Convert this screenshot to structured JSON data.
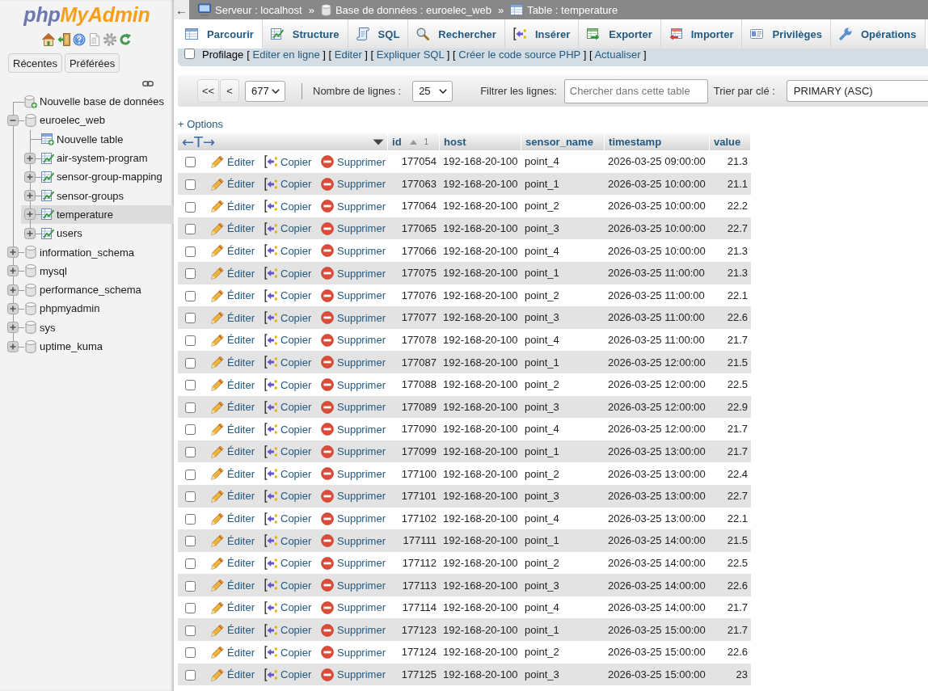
{
  "sidebar": {
    "logo": {
      "prefix": "php",
      "name": "MyAdmin"
    },
    "buttons": [
      "Récentes",
      "Préférées"
    ],
    "tree": [
      {
        "label": "Nouvelle base de données",
        "kind": "new_database",
        "selected": false
      },
      {
        "label": "euroelec_web",
        "kind": "database",
        "expanded": true,
        "selected": false,
        "children": [
          {
            "label": "Nouvelle table",
            "kind": "new_table",
            "selected": false
          },
          {
            "label": "air-system-program",
            "kind": "table",
            "expanded": false,
            "selected": false
          },
          {
            "label": "sensor-group-mapping",
            "kind": "table",
            "expanded": false,
            "selected": false
          },
          {
            "label": "sensor-groups",
            "kind": "table",
            "expanded": false,
            "selected": false
          },
          {
            "label": "temperature",
            "kind": "table",
            "expanded": false,
            "selected": true
          },
          {
            "label": "users",
            "kind": "table",
            "expanded": false,
            "selected": false
          }
        ]
      },
      {
        "label": "information_schema",
        "kind": "database",
        "expanded": false,
        "selected": false
      },
      {
        "label": "mysql",
        "kind": "database",
        "expanded": false,
        "selected": false
      },
      {
        "label": "performance_schema",
        "kind": "database",
        "expanded": false,
        "selected": false
      },
      {
        "label": "phpmyadmin",
        "kind": "database",
        "expanded": false,
        "selected": false
      },
      {
        "label": "sys",
        "kind": "database",
        "expanded": false,
        "selected": false
      },
      {
        "label": "uptime_kuma",
        "kind": "database",
        "expanded": false,
        "selected": false
      }
    ]
  },
  "breadcrumb": {
    "collapse_button": "←",
    "items": [
      {
        "kind": "server",
        "label": "Serveur : localhost"
      },
      {
        "kind": "separator",
        "label": "»"
      },
      {
        "kind": "database",
        "label": "Base de données : euroelec_web"
      },
      {
        "kind": "separator",
        "label": "»"
      },
      {
        "kind": "table",
        "label": "Table : temperature"
      }
    ]
  },
  "tabs": [
    {
      "kind": "browse",
      "label": "Parcourir",
      "selected": true
    },
    {
      "kind": "structure",
      "label": "Structure",
      "selected": false
    },
    {
      "kind": "sql",
      "label": "SQL",
      "selected": false
    },
    {
      "kind": "search",
      "label": "Rechercher",
      "selected": false
    },
    {
      "kind": "insert",
      "label": "Insérer",
      "selected": false
    },
    {
      "kind": "export",
      "label": "Exporter",
      "selected": false
    },
    {
      "kind": "import",
      "label": "Importer",
      "selected": false
    },
    {
      "kind": "privileges",
      "label": "Privilèges",
      "selected": false
    },
    {
      "kind": "operations",
      "label": "Opérations",
      "selected": false
    }
  ],
  "query_bar": {
    "profiling": {
      "label": "Profilage",
      "checked": false
    },
    "links": [
      {
        "open": "[",
        "label": "Editer en ligne",
        "close": "]"
      },
      {
        "open": "[",
        "label": "Editer",
        "close": "]"
      },
      {
        "open": "[",
        "label": "Expliquer SQL",
        "close": "]"
      },
      {
        "open": "[",
        "label": "Créer le code source PHP",
        "close": "]"
      },
      {
        "open": "[",
        "label": "Actualiser",
        "close": "]"
      }
    ]
  },
  "navigation": {
    "first_button": "<<",
    "previous_button": "<",
    "page": "677",
    "rows_label": "Nombre de lignes :",
    "rows": "25",
    "filter_label": "Filtrer les lignes:",
    "filter_placeholder": "Chercher dans cette table",
    "sort_label": "Trier par clé :",
    "sort": "PRIMARY (ASC)"
  },
  "results": {
    "options_link": "+ Options",
    "column_toggle": "←T→",
    "columns": [
      {
        "label": "id",
        "kind": "number",
        "sorted": true,
        "sort_order": "1"
      },
      {
        "label": "host",
        "kind": "text",
        "sorted": false
      },
      {
        "label": "sensor_name",
        "kind": "text",
        "sorted": false
      },
      {
        "label": "timestamp",
        "kind": "text",
        "sorted": false
      },
      {
        "label": "value",
        "kind": "number",
        "sorted": false
      }
    ],
    "rows": [
      {
        "selected": false,
        "actions": [
          {
            "kind": "edit",
            "label": "Éditer"
          },
          {
            "kind": "copy",
            "label": "Copier"
          },
          {
            "kind": "delete",
            "label": "Supprimer"
          }
        ],
        "cells": [
          "177054",
          "192-168-20-100",
          "point_4",
          "2026-03-25 09:00:00",
          "21.3"
        ]
      },
      {
        "selected": false,
        "actions": [
          {
            "kind": "edit",
            "label": "Éditer"
          },
          {
            "kind": "copy",
            "label": "Copier"
          },
          {
            "kind": "delete",
            "label": "Supprimer"
          }
        ],
        "cells": [
          "177063",
          "192-168-20-100",
          "point_1",
          "2026-03-25 10:00:00",
          "21.1"
        ]
      },
      {
        "selected": false,
        "actions": [
          {
            "kind": "edit",
            "label": "Éditer"
          },
          {
            "kind": "copy",
            "label": "Copier"
          },
          {
            "kind": "delete",
            "label": "Supprimer"
          }
        ],
        "cells": [
          "177064",
          "192-168-20-100",
          "point_2",
          "2026-03-25 10:00:00",
          "22.2"
        ]
      },
      {
        "selected": false,
        "actions": [
          {
            "kind": "edit",
            "label": "Éditer"
          },
          {
            "kind": "copy",
            "label": "Copier"
          },
          {
            "kind": "delete",
            "label": "Supprimer"
          }
        ],
        "cells": [
          "177065",
          "192-168-20-100",
          "point_3",
          "2026-03-25 10:00:00",
          "22.7"
        ]
      },
      {
        "selected": false,
        "actions": [
          {
            "kind": "edit",
            "label": "Éditer"
          },
          {
            "kind": "copy",
            "label": "Copier"
          },
          {
            "kind": "delete",
            "label": "Supprimer"
          }
        ],
        "cells": [
          "177066",
          "192-168-20-100",
          "point_4",
          "2026-03-25 10:00:00",
          "21.3"
        ]
      },
      {
        "selected": false,
        "actions": [
          {
            "kind": "edit",
            "label": "Éditer"
          },
          {
            "kind": "copy",
            "label": "Copier"
          },
          {
            "kind": "delete",
            "label": "Supprimer"
          }
        ],
        "cells": [
          "177075",
          "192-168-20-100",
          "point_1",
          "2026-03-25 11:00:00",
          "21.3"
        ]
      },
      {
        "selected": false,
        "actions": [
          {
            "kind": "edit",
            "label": "Éditer"
          },
          {
            "kind": "copy",
            "label": "Copier"
          },
          {
            "kind": "delete",
            "label": "Supprimer"
          }
        ],
        "cells": [
          "177076",
          "192-168-20-100",
          "point_2",
          "2026-03-25 11:00:00",
          "22.1"
        ]
      },
      {
        "selected": false,
        "actions": [
          {
            "kind": "edit",
            "label": "Éditer"
          },
          {
            "kind": "copy",
            "label": "Copier"
          },
          {
            "kind": "delete",
            "label": "Supprimer"
          }
        ],
        "cells": [
          "177077",
          "192-168-20-100",
          "point_3",
          "2026-03-25 11:00:00",
          "22.6"
        ]
      },
      {
        "selected": false,
        "actions": [
          {
            "kind": "edit",
            "label": "Éditer"
          },
          {
            "kind": "copy",
            "label": "Copier"
          },
          {
            "kind": "delete",
            "label": "Supprimer"
          }
        ],
        "cells": [
          "177078",
          "192-168-20-100",
          "point_4",
          "2026-03-25 11:00:00",
          "21.7"
        ]
      },
      {
        "selected": false,
        "actions": [
          {
            "kind": "edit",
            "label": "Éditer"
          },
          {
            "kind": "copy",
            "label": "Copier"
          },
          {
            "kind": "delete",
            "label": "Supprimer"
          }
        ],
        "cells": [
          "177087",
          "192-168-20-100",
          "point_1",
          "2026-03-25 12:00:00",
          "21.5"
        ]
      },
      {
        "selected": false,
        "actions": [
          {
            "kind": "edit",
            "label": "Éditer"
          },
          {
            "kind": "copy",
            "label": "Copier"
          },
          {
            "kind": "delete",
            "label": "Supprimer"
          }
        ],
        "cells": [
          "177088",
          "192-168-20-100",
          "point_2",
          "2026-03-25 12:00:00",
          "22.5"
        ]
      },
      {
        "selected": false,
        "actions": [
          {
            "kind": "edit",
            "label": "Éditer"
          },
          {
            "kind": "copy",
            "label": "Copier"
          },
          {
            "kind": "delete",
            "label": "Supprimer"
          }
        ],
        "cells": [
          "177089",
          "192-168-20-100",
          "point_3",
          "2026-03-25 12:00:00",
          "22.9"
        ]
      },
      {
        "selected": false,
        "actions": [
          {
            "kind": "edit",
            "label": "Éditer"
          },
          {
            "kind": "copy",
            "label": "Copier"
          },
          {
            "kind": "delete",
            "label": "Supprimer"
          }
        ],
        "cells": [
          "177090",
          "192-168-20-100",
          "point_4",
          "2026-03-25 12:00:00",
          "21.7"
        ]
      },
      {
        "selected": false,
        "actions": [
          {
            "kind": "edit",
            "label": "Éditer"
          },
          {
            "kind": "copy",
            "label": "Copier"
          },
          {
            "kind": "delete",
            "label": "Supprimer"
          }
        ],
        "cells": [
          "177099",
          "192-168-20-100",
          "point_1",
          "2026-03-25 13:00:00",
          "21.7"
        ]
      },
      {
        "selected": false,
        "actions": [
          {
            "kind": "edit",
            "label": "Éditer"
          },
          {
            "kind": "copy",
            "label": "Copier"
          },
          {
            "kind": "delete",
            "label": "Supprimer"
          }
        ],
        "cells": [
          "177100",
          "192-168-20-100",
          "point_2",
          "2026-03-25 13:00:00",
          "22.4"
        ]
      },
      {
        "selected": false,
        "actions": [
          {
            "kind": "edit",
            "label": "Éditer"
          },
          {
            "kind": "copy",
            "label": "Copier"
          },
          {
            "kind": "delete",
            "label": "Supprimer"
          }
        ],
        "cells": [
          "177101",
          "192-168-20-100",
          "point_3",
          "2026-03-25 13:00:00",
          "22.7"
        ]
      },
      {
        "selected": false,
        "actions": [
          {
            "kind": "edit",
            "label": "Éditer"
          },
          {
            "kind": "copy",
            "label": "Copier"
          },
          {
            "kind": "delete",
            "label": "Supprimer"
          }
        ],
        "cells": [
          "177102",
          "192-168-20-100",
          "point_4",
          "2026-03-25 13:00:00",
          "22.1"
        ]
      },
      {
        "selected": false,
        "actions": [
          {
            "kind": "edit",
            "label": "Éditer"
          },
          {
            "kind": "copy",
            "label": "Copier"
          },
          {
            "kind": "delete",
            "label": "Supprimer"
          }
        ],
        "cells": [
          "177111",
          "192-168-20-100",
          "point_1",
          "2026-03-25 14:00:00",
          "21.5"
        ]
      },
      {
        "selected": false,
        "actions": [
          {
            "kind": "edit",
            "label": "Éditer"
          },
          {
            "kind": "copy",
            "label": "Copier"
          },
          {
            "kind": "delete",
            "label": "Supprimer"
          }
        ],
        "cells": [
          "177112",
          "192-168-20-100",
          "point_2",
          "2026-03-25 14:00:00",
          "22.5"
        ]
      },
      {
        "selected": false,
        "actions": [
          {
            "kind": "edit",
            "label": "Éditer"
          },
          {
            "kind": "copy",
            "label": "Copier"
          },
          {
            "kind": "delete",
            "label": "Supprimer"
          }
        ],
        "cells": [
          "177113",
          "192-168-20-100",
          "point_3",
          "2026-03-25 14:00:00",
          "22.6"
        ]
      },
      {
        "selected": false,
        "actions": [
          {
            "kind": "edit",
            "label": "Éditer"
          },
          {
            "kind": "copy",
            "label": "Copier"
          },
          {
            "kind": "delete",
            "label": "Supprimer"
          }
        ],
        "cells": [
          "177114",
          "192-168-20-100",
          "point_4",
          "2026-03-25 14:00:00",
          "21.7"
        ]
      },
      {
        "selected": false,
        "actions": [
          {
            "kind": "edit",
            "label": "Éditer"
          },
          {
            "kind": "copy",
            "label": "Copier"
          },
          {
            "kind": "delete",
            "label": "Supprimer"
          }
        ],
        "cells": [
          "177123",
          "192-168-20-100",
          "point_1",
          "2026-03-25 15:00:00",
          "21.7"
        ]
      },
      {
        "selected": false,
        "actions": [
          {
            "kind": "edit",
            "label": "Éditer"
          },
          {
            "kind": "copy",
            "label": "Copier"
          },
          {
            "kind": "delete",
            "label": "Supprimer"
          }
        ],
        "cells": [
          "177124",
          "192-168-20-100",
          "point_2",
          "2026-03-25 15:00:00",
          "22.6"
        ]
      },
      {
        "selected": false,
        "actions": [
          {
            "kind": "edit",
            "label": "Éditer"
          },
          {
            "kind": "copy",
            "label": "Copier"
          },
          {
            "kind": "delete",
            "label": "Supprimer"
          }
        ],
        "cells": [
          "177125",
          "192-168-20-100",
          "point_3",
          "2026-03-25 15:00:00",
          "23"
        ]
      }
    ]
  }
}
